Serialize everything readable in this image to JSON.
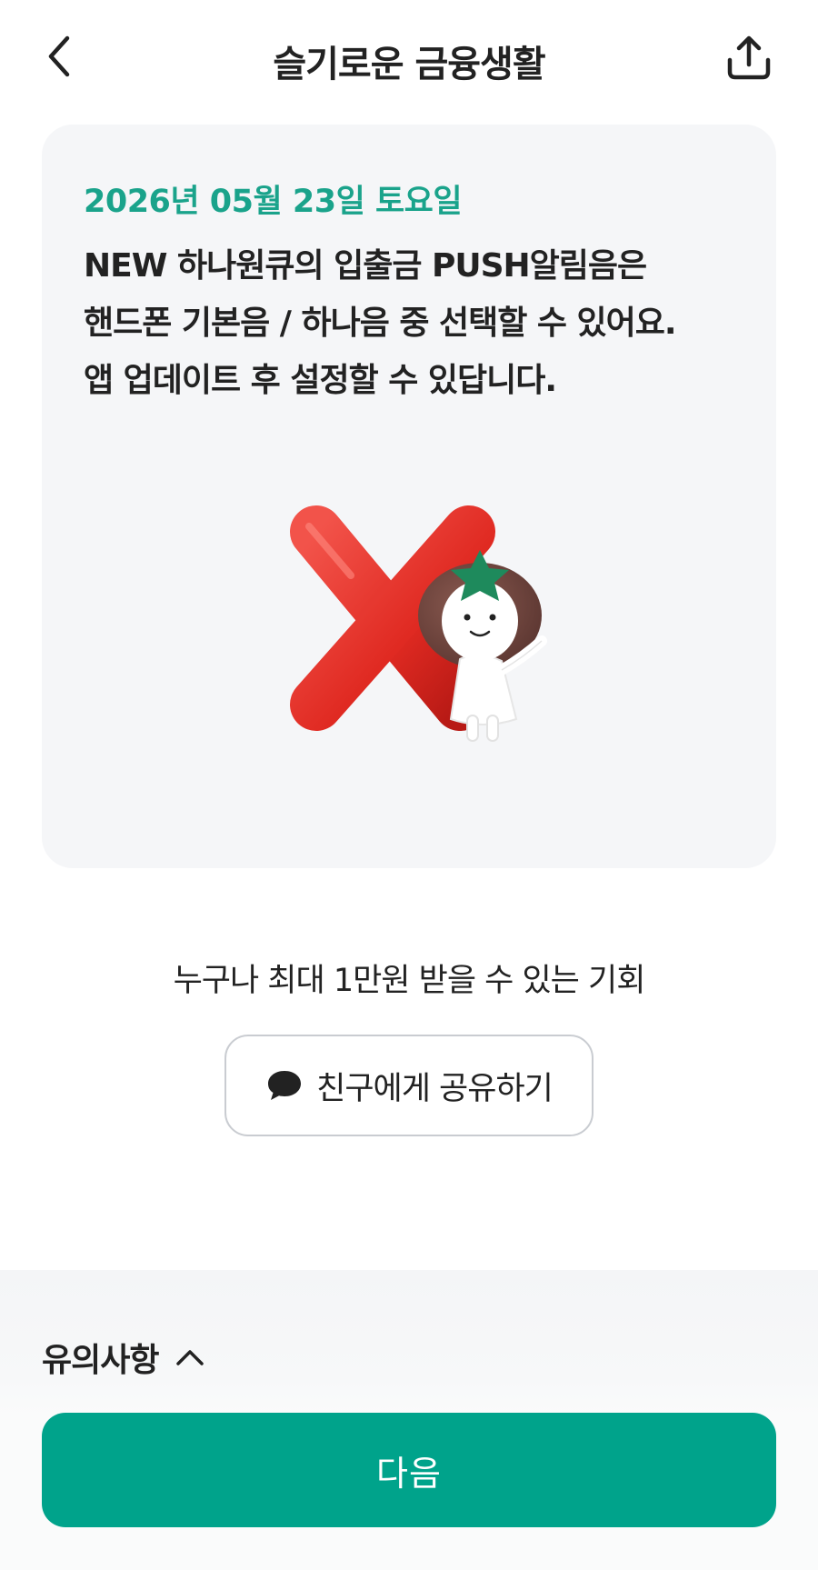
{
  "header": {
    "title": "슬기로운 금융생활",
    "back_icon": "chevron-left-icon",
    "share_icon": "share-upload-icon"
  },
  "card": {
    "date": "2026년 05월 23일 토요일",
    "lines": [
      "NEW 하나원큐의 입출금 PUSH알림음은",
      "핸드폰 기본음 / 하나음 중 선택할 수 있어요.",
      "앱 업데이트 후 설정할 수 있답니다."
    ],
    "illustration": "red-x-mascot-illustration"
  },
  "promo": {
    "text": "누구나 최대 1만원 받을 수 있는 기회",
    "share_button_label": "친구에게 공유하기",
    "share_button_icon": "speech-bubble-icon"
  },
  "notice": {
    "label": "유의사항",
    "toggle_icon": "chevron-up-icon"
  },
  "footer": {
    "next_label": "다음"
  },
  "colors": {
    "accent": "#1aa38b",
    "button": "#00a38b",
    "card_bg": "#f5f6f8",
    "x_red": "#e52e25"
  }
}
